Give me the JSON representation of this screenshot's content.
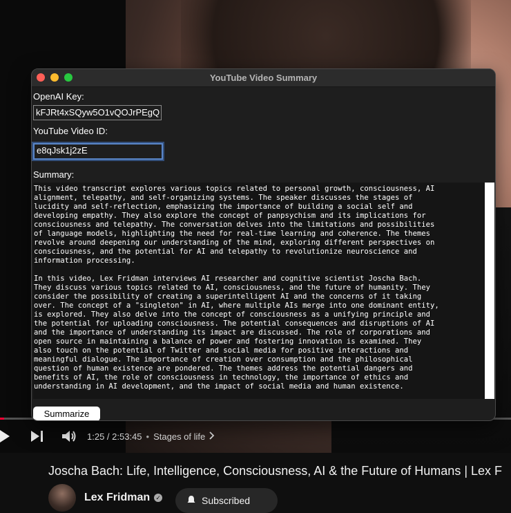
{
  "window": {
    "title": "YouTube Video Summary"
  },
  "form": {
    "openai_key_label": "OpenAI Key:",
    "openai_key_value": "kFJRt4xSQyw5O1vQOJrPEgQ",
    "video_id_label": "YouTube Video ID:",
    "video_id_value": "e8qJsk1j2zE",
    "summary_label": "Summary:",
    "summary_text": "This video transcript explores various topics related to personal growth, consciousness, AI\nalignment, telepathy, and self-organizing systems. The speaker discusses the stages of\nlucidity and self-reflection, emphasizing the importance of building a social self and\ndeveloping empathy. They also explore the concept of panpsychism and its implications for\nconsciousness and telepathy. The conversation delves into the limitations and possibilities\nof language models, highlighting the need for real-time learning and coherence. The themes\nrevolve around deepening our understanding of the mind, exploring different perspectives on\nconsciousness, and the potential for AI and telepathy to revolutionize neuroscience and\ninformation processing.\n\nIn this video, Lex Fridman interviews AI researcher and cognitive scientist Joscha Bach.\nThey discuss various topics related to AI, consciousness, and the future of humanity. They\nconsider the possibility of creating a superintelligent AI and the concerns of it taking\nover. The concept of a \"singleton\" in AI, where multiple AIs merge into one dominant entity,\nis explored. They also delve into the concept of consciousness as a unifying principle and\nthe potential for uploading consciousness. The potential consequences and disruptions of AI\nand the importance of understanding its impact are discussed. The role of corporations and\nopen source in maintaining a balance of power and fostering innovation is examined. They\nalso touch on the potential of Twitter and social media for positive interactions and\nmeaningful dialogue. The importance of creation over consumption and the philosophical\nquestion of human existence are pondered. The themes address the potential dangers and\nbenefits of AI, the role of consciousness in technology, the importance of ethics and\nunderstanding in AI development, and the impact of social media and human existence.",
    "summarize_button": "Summarize"
  },
  "player": {
    "time_current": "1:25",
    "time_separator": " / ",
    "time_total": "2:53:45",
    "chapter": "Stages of life",
    "progress": 0.008,
    "icons": [
      "play-icon",
      "next-icon",
      "volume-icon",
      "chevron-right-icon"
    ]
  },
  "video": {
    "title": "Joscha Bach: Life, Intelligence, Consciousness, AI & the Future of Humans | Lex F",
    "channel": "Lex Fridman",
    "subscribe": "Subscribed"
  },
  "colors": {
    "window_bg": "#1e1e1e",
    "titlebar_bg": "#2c2c2c",
    "focus_ring": "#5a86c9",
    "progress_red": "#ff0033",
    "close": "#ff5f57",
    "minimize": "#febc2e",
    "maximize": "#28c840"
  }
}
